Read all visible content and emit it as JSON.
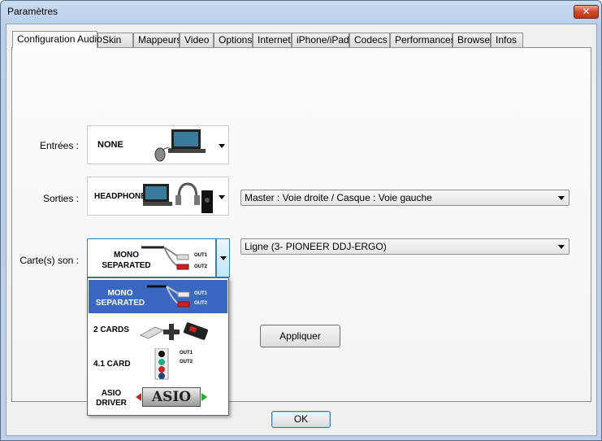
{
  "window": {
    "title": "Paramètres",
    "close_glyph": "✕"
  },
  "tabs": [
    {
      "label": "Configuration Audio",
      "active": true
    },
    {
      "label": "Skin"
    },
    {
      "label": "Mappeurs"
    },
    {
      "label": "Video"
    },
    {
      "label": "Options"
    },
    {
      "label": "Internet"
    },
    {
      "label": "iPhone/iPad"
    },
    {
      "label": "Codecs"
    },
    {
      "label": "Performances"
    },
    {
      "label": "Browser"
    },
    {
      "label": "Infos"
    }
  ],
  "inputs": {
    "label": "Entrées :",
    "selected": "NONE"
  },
  "outputs": {
    "label": "Sorties :",
    "selected": "HEADPHONES",
    "routing_value": "Master : Voie droite / Casque : Voie gauche"
  },
  "soundcards": {
    "label": "Carte(s) son :",
    "selected_line1": "MONO",
    "selected_line2": "SEPARATED",
    "device_value": "Ligne (3- PIONEER DDJ-ERGO)",
    "out1": "OUT1",
    "out2": "OUT2",
    "options": [
      {
        "line1": "MONO",
        "line2": "SEPARATED"
      },
      {
        "line1": "2 CARDS",
        "line2": ""
      },
      {
        "line1": "4.1 CARD",
        "line2": ""
      },
      {
        "line1": "ASIO",
        "line2": "DRIVER"
      }
    ],
    "asio_logo": "ASIO"
  },
  "buttons": {
    "apply": "Appliquer",
    "ok": "OK"
  },
  "colors": {
    "selection": "#3a68c1",
    "close": "#c13517"
  }
}
